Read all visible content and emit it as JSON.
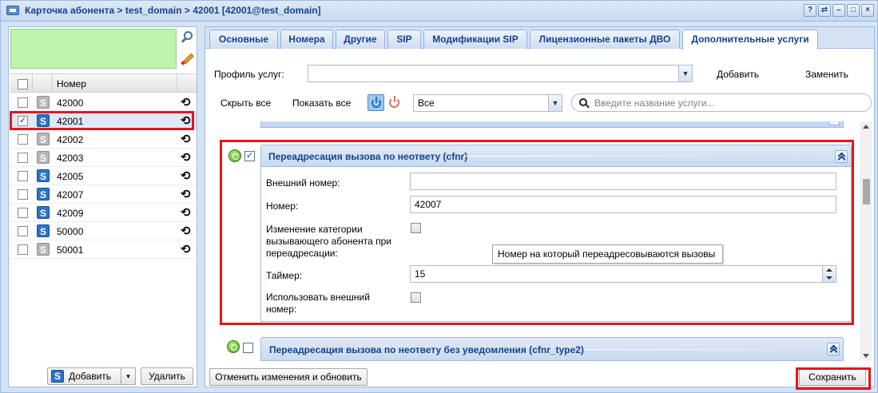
{
  "window": {
    "title": "Карточка абонента > test_domain > 42001 [42001@test_domain]",
    "tool_buttons": [
      "?",
      "⇄",
      "–",
      "□",
      "×"
    ]
  },
  "left_panel": {
    "column_header": "Номер",
    "rows": [
      {
        "number": "42000",
        "checked": false,
        "icon": "grey"
      },
      {
        "number": "42001",
        "checked": true,
        "icon": "blue",
        "selected": true
      },
      {
        "number": "42002",
        "checked": false,
        "icon": "grey"
      },
      {
        "number": "42003",
        "checked": false,
        "icon": "grey"
      },
      {
        "number": "42005",
        "checked": false,
        "icon": "blue"
      },
      {
        "number": "42007",
        "checked": false,
        "icon": "blue"
      },
      {
        "number": "42009",
        "checked": false,
        "icon": "blue"
      },
      {
        "number": "50000",
        "checked": false,
        "icon": "blue"
      },
      {
        "number": "50001",
        "checked": false,
        "icon": "grey"
      }
    ],
    "add_label": "Добавить",
    "delete_label": "Удалить",
    "s_glyph": "S",
    "history_glyph": "⟲",
    "check_glyph": "✓",
    "dropdown_glyph": "▾"
  },
  "tabs": [
    {
      "label": "Основные",
      "active": false
    },
    {
      "label": "Номера",
      "active": false
    },
    {
      "label": "Другие",
      "active": false
    },
    {
      "label": "SIP",
      "active": false
    },
    {
      "label": "Модификации SIP",
      "active": false
    },
    {
      "label": "Лицензионные пакеты ДВО",
      "active": false
    },
    {
      "label": "Дополнительные услуги",
      "active": true
    }
  ],
  "toolbar": {
    "profile_label": "Профиль услуг:",
    "profile_value": "",
    "add_label": "Добавить",
    "replace_label": "Заменить",
    "hide_all": "Скрыть все",
    "show_all": "Показать все",
    "filter_value": "Все",
    "search_placeholder": "Введите название услуги...",
    "arrow_glyph": "▼"
  },
  "service_cfnr": {
    "title": "Переадресация вызова по неответу (cfnr)",
    "enabled": true,
    "checked": true,
    "external_number_label": "Внешний номер:",
    "external_number_value": "",
    "number_label": "Номер:",
    "number_value": "42007",
    "change_category_label_1": "Изменение категории",
    "change_category_label_2": "вызывающего абонента при",
    "change_category_label_3": "переадресации:",
    "timer_label": "Таймер:",
    "timer_value": "15",
    "use_external_label_1": "Использовать внешний",
    "use_external_label_2": "номер:",
    "tooltip": "Номер на который переадресовываются вызовы"
  },
  "service_cfnr_type2": {
    "title": "Переадресация вызова по неответу без уведомления (cfnr_type2)"
  },
  "bottom": {
    "reset_label": "Отменить изменения и обновить",
    "save_label": "Сохранить"
  },
  "colors": {
    "highlight": "#e8141c",
    "header_text": "#15428b",
    "panel_border": "#99bbe8",
    "green_area": "#bcf5a9"
  }
}
